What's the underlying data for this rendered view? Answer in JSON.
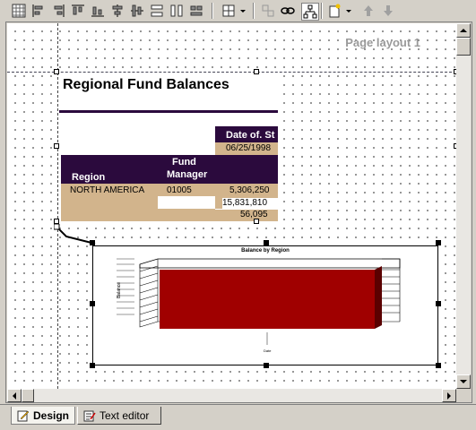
{
  "toolbar": {
    "buttons": [
      {
        "icon": "grid-icon"
      },
      {
        "icon": "align-left-icon"
      },
      {
        "icon": "align-right-icon"
      },
      {
        "icon": "align-top-icon"
      },
      {
        "icon": "align-bottom-icon"
      },
      {
        "icon": "center-horizontal-icon"
      },
      {
        "icon": "center-vertical-icon"
      },
      {
        "icon": "same-height-icon"
      },
      {
        "icon": "same-width-icon"
      },
      {
        "icon": "layout-icon"
      },
      {
        "icon": "group-icon"
      },
      {
        "icon": "link-icon"
      },
      {
        "icon": "hierarchy-icon"
      },
      {
        "icon": "new-item-icon"
      },
      {
        "icon": "move-up-arrow-icon"
      },
      {
        "icon": "move-down-arrow-icon"
      }
    ]
  },
  "canvas": {
    "page_label": "Page layout 1"
  },
  "report": {
    "title": "Regional Fund Balances",
    "date_header": "Date of. St",
    "date_value": "06/25/1998",
    "col_region": "Region",
    "col_fund_manager_1": "Fund",
    "col_fund_manager_2": "Manager",
    "row_region": "NORTH AMERICA",
    "row_manager": "01005",
    "amounts": [
      "5,306,250",
      "15,831,810",
      "56,095"
    ]
  },
  "chart": {
    "title": "Balance by Region",
    "ylabel": "Balance",
    "xlabel": "Date",
    "bar_color": "#a00000"
  },
  "tabs": [
    {
      "label": "Design",
      "icon": "design-icon",
      "active": true
    },
    {
      "label": "Text editor",
      "icon": "text-editor-icon",
      "active": false
    }
  ]
}
